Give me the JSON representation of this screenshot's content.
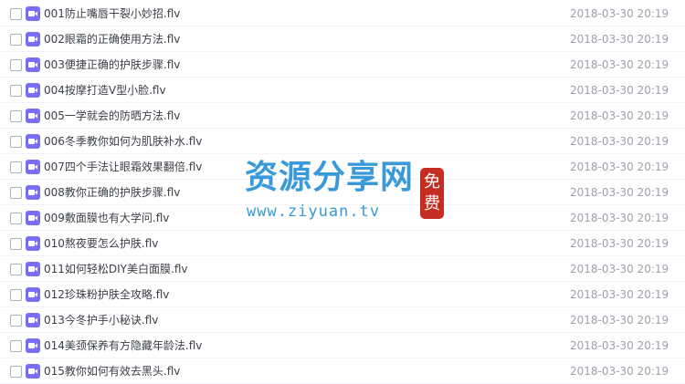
{
  "icons": {
    "file_type": "video-file-icon",
    "color": "#7b6ef6"
  },
  "files": [
    {
      "name": "001防止嘴唇干裂小妙招.flv",
      "date": "2018-03-30 20:19"
    },
    {
      "name": "002眼霜的正确使用方法.flv",
      "date": "2018-03-30 20:19"
    },
    {
      "name": "003便捷正确的护肤步骤.flv",
      "date": "2018-03-30 20:19"
    },
    {
      "name": "004按摩打造V型小脸.flv",
      "date": "2018-03-30 20:19"
    },
    {
      "name": "005一学就会的防晒方法.flv",
      "date": "2018-03-30 20:19"
    },
    {
      "name": "006冬季教你如何为肌肤补水.flv",
      "date": "2018-03-30 20:19"
    },
    {
      "name": "007四个手法让眼霜效果翻倍.flv",
      "date": "2018-03-30 20:19"
    },
    {
      "name": "008教你正确的护肤步骤.flv",
      "date": "2018-03-30 20:19"
    },
    {
      "name": "009敷面膜也有大学问.flv",
      "date": "2018-03-30 20:19"
    },
    {
      "name": "010熬夜要怎么护肤.flv",
      "date": "2018-03-30 20:19"
    },
    {
      "name": "011如何轻松DIY美白面膜.flv",
      "date": "2018-03-30 20:19"
    },
    {
      "name": "012珍珠粉护肤全攻略.flv",
      "date": "2018-03-30 20:19"
    },
    {
      "name": "013今冬护手小秘诀.flv",
      "date": "2018-03-30 20:19"
    },
    {
      "name": "014美颈保养有方隐藏年龄法.flv",
      "date": "2018-03-30 20:19"
    },
    {
      "name": "015教你如何有效去黑头.flv",
      "date": "2018-03-30 20:19"
    }
  ],
  "watermark": {
    "title": "资源分享网",
    "url": "www.ziyuan.tv",
    "seal_top": "免",
    "seal_bottom": "费",
    "color": "#3a9ad9",
    "seal_color": "#c62d22"
  }
}
